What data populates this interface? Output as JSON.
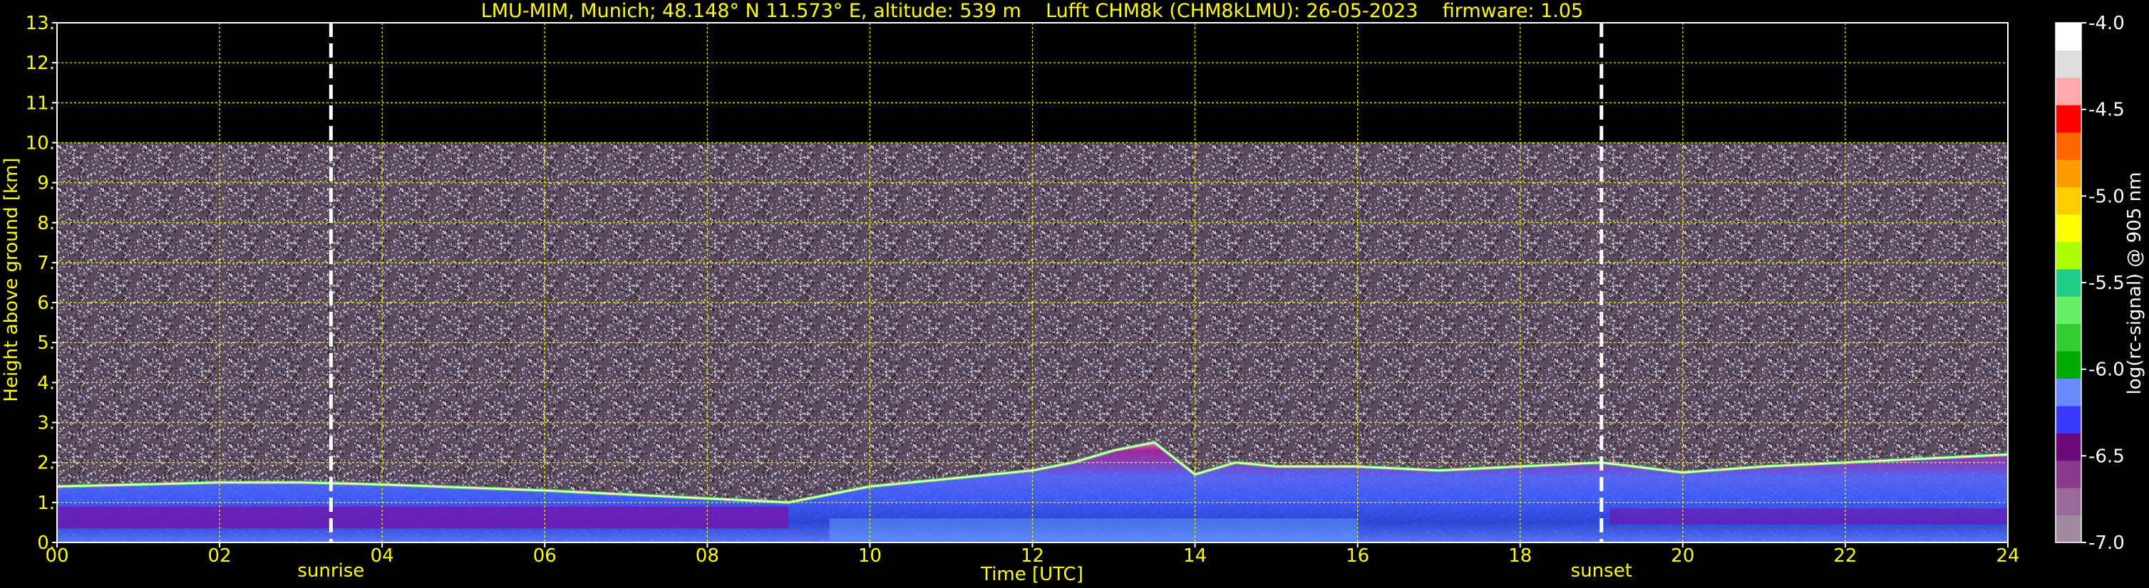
{
  "chart_data": {
    "type": "heatmap",
    "title": "LMU-MIM, Munich; 48.148° N 11.573° E, altitude: 539 m    Lufft CHM8k (CHM8kLMU): 26-05-2023    firmware: 1.05",
    "xlabel": "Time [UTC]",
    "ylabel": "Height above ground [km]",
    "xlim": [
      0,
      24
    ],
    "ylim": [
      0,
      13
    ],
    "x_ticks": [
      "00",
      "02",
      "04",
      "06",
      "08",
      "10",
      "12",
      "14",
      "16",
      "18",
      "20",
      "22",
      "24"
    ],
    "x_tick_values": [
      0,
      2,
      4,
      6,
      8,
      10,
      12,
      14,
      16,
      18,
      20,
      22,
      24
    ],
    "y_ticks": [
      "0.",
      "1.",
      "2.",
      "3.",
      "4.",
      "5.",
      "6.",
      "7.",
      "8.",
      "9.",
      "10.",
      "11.",
      "12.",
      "13."
    ],
    "y_tick_values": [
      0,
      1,
      2,
      3,
      4,
      5,
      6,
      7,
      8,
      9,
      10,
      11,
      12,
      13
    ],
    "grid": true,
    "measurement_top_km": 10,
    "markers": [
      {
        "label": "sunrise",
        "x": 3.37
      },
      {
        "label": "sunset",
        "x": 19.0
      }
    ],
    "boundary_layer_top_km": {
      "x": [
        0,
        1,
        2,
        3,
        4,
        6,
        8,
        9,
        9.5,
        10,
        10.5,
        11,
        11.5,
        12,
        12.5,
        13,
        13.5,
        14,
        14.5,
        15,
        16,
        17,
        18,
        19,
        20,
        21,
        22,
        23,
        24
      ],
      "y": [
        1.4,
        1.45,
        1.5,
        1.5,
        1.45,
        1.3,
        1.1,
        1.0,
        1.2,
        1.4,
        1.5,
        1.6,
        1.7,
        1.8,
        2.0,
        2.3,
        2.5,
        1.7,
        2.0,
        1.9,
        1.9,
        1.8,
        1.9,
        2.0,
        1.75,
        1.9,
        2.0,
        2.1,
        2.2
      ]
    },
    "colorbar": {
      "label": "log(rc-signal) @ 905 nm",
      "range": [
        -7.0,
        -4.0
      ],
      "ticks": [
        "-4.0",
        "-4.5",
        "-5.0",
        "-5.5",
        "-6.0",
        "-6.5",
        "-7.0"
      ],
      "tick_values": [
        -4.0,
        -4.5,
        -5.0,
        -5.5,
        -6.0,
        -6.5,
        -7.0
      ],
      "colors": [
        "#a08aa0",
        "#9a6a9a",
        "#8a3a8a",
        "#6a0a7a",
        "#3a3aff",
        "#6a8aff",
        "#00aa00",
        "#33cc33",
        "#66ee66",
        "#22cc88",
        "#aaff00",
        "#ffff00",
        "#ffcc00",
        "#ff9900",
        "#ff6600",
        "#ff0000",
        "#ffaaaa",
        "#dddddd",
        "#ffffff"
      ]
    }
  }
}
